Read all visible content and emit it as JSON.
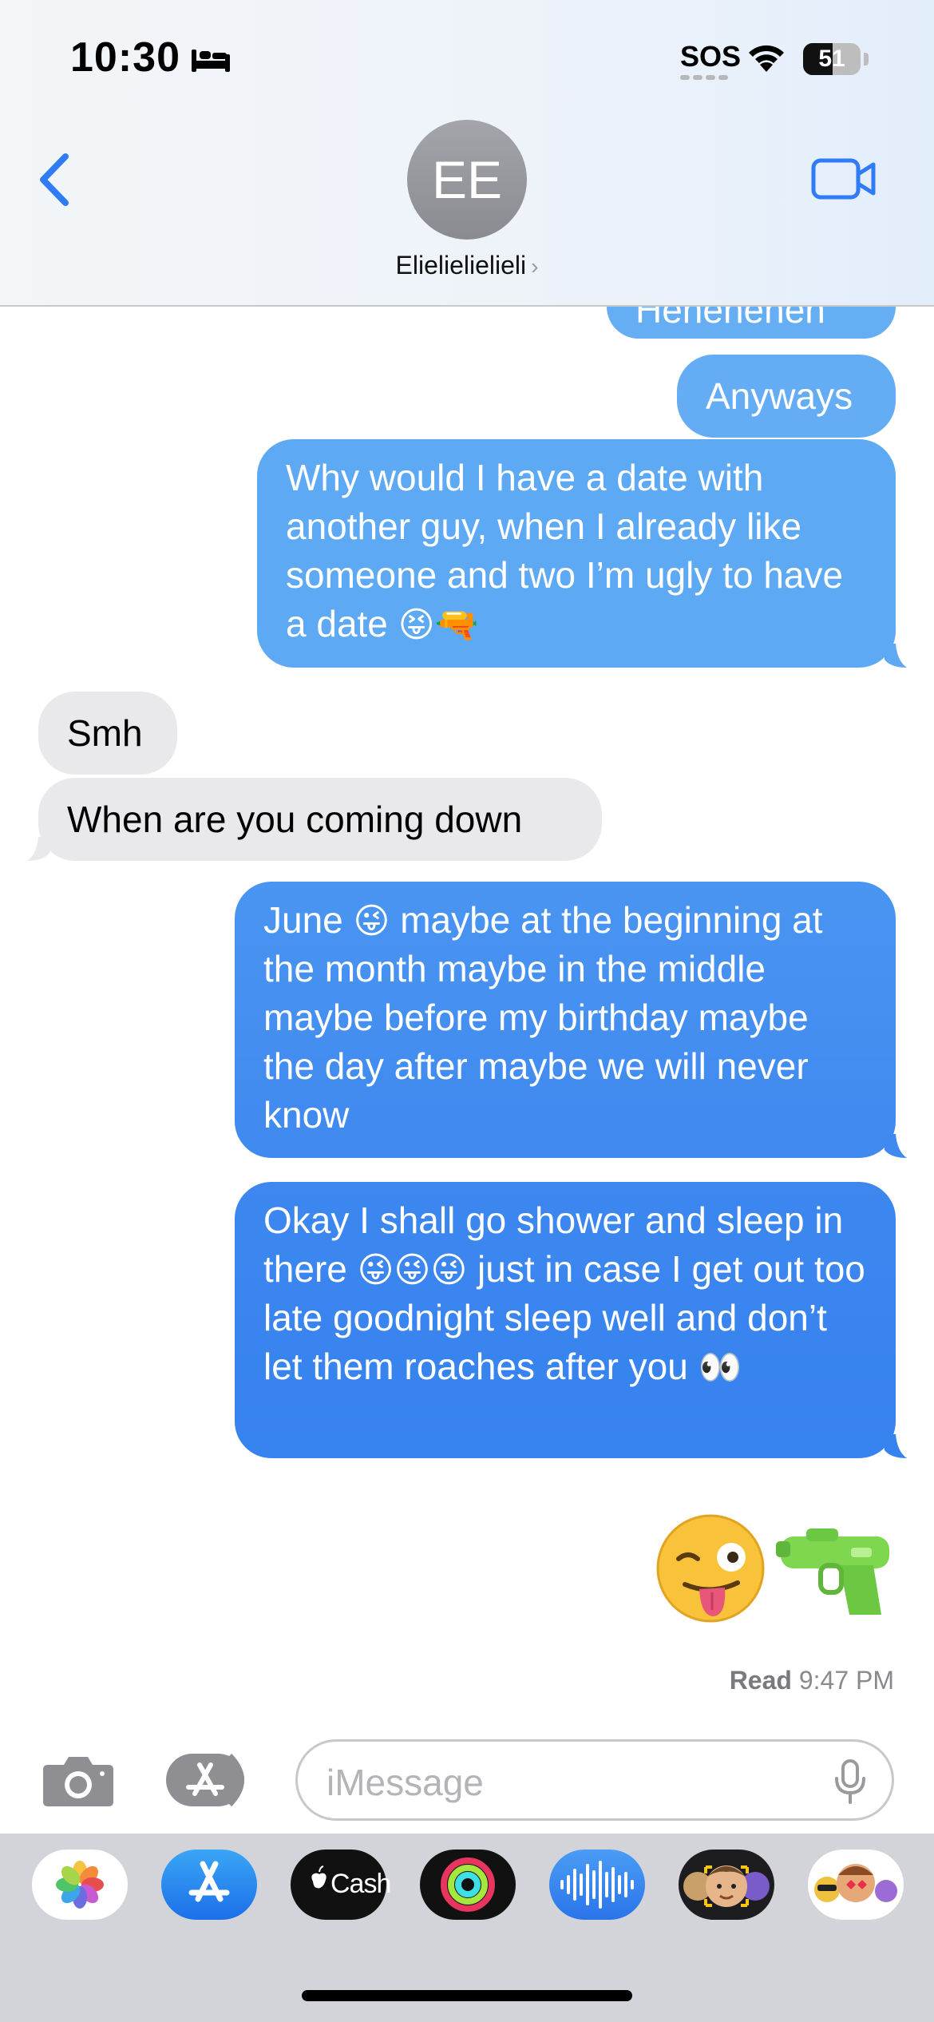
{
  "status_bar": {
    "time": "10:30",
    "sos": "SOS",
    "battery": "51",
    "battery_level": 0.51
  },
  "header": {
    "avatar_initials": "EE",
    "contact_name": "Elielielielieli",
    "chevron": "›"
  },
  "messages": [
    {
      "side": "sent",
      "text": "Heheheheh"
    },
    {
      "side": "sent",
      "text": "Anyways"
    },
    {
      "side": "sent",
      "text": "Why would I have a date with another guy, when I already like someone and two I’m ugly to have a date",
      "emojis": "😝🔫"
    },
    {
      "side": "received",
      "text": "Smh"
    },
    {
      "side": "received",
      "text": "When are you coming down"
    },
    {
      "side": "sent",
      "text_before": "June",
      "emoji": "😜",
      "text_after": "maybe at the beginning at the month maybe in the middle maybe before my birthday maybe the day after maybe we will never know"
    },
    {
      "side": "sent",
      "text_before": "Okay I shall go shower and sleep in there",
      "emoji": "😜😜😜",
      "text_after": "just in case I get out too late goodnight sleep well and don’t let them roaches after you",
      "emoji_end": "👀"
    }
  ],
  "big_emojis": "😜🔫",
  "read_receipt": {
    "label": "Read",
    "time": "9:47 PM"
  },
  "input": {
    "placeholder": "iMessage"
  },
  "app_drawer": {
    "cash_label": "Cash",
    "apps": [
      "photos-app",
      "app-store-app",
      "apple-cash-app",
      "activity-app",
      "audio-message-app",
      "memoji-camera-app",
      "memoji-stickers-app"
    ]
  },
  "colors": {
    "sent_top": "#64adf4",
    "sent_bottom": "#3a83ef",
    "received": "#e9e9eb",
    "ios_blue": "#2f7cf6"
  }
}
